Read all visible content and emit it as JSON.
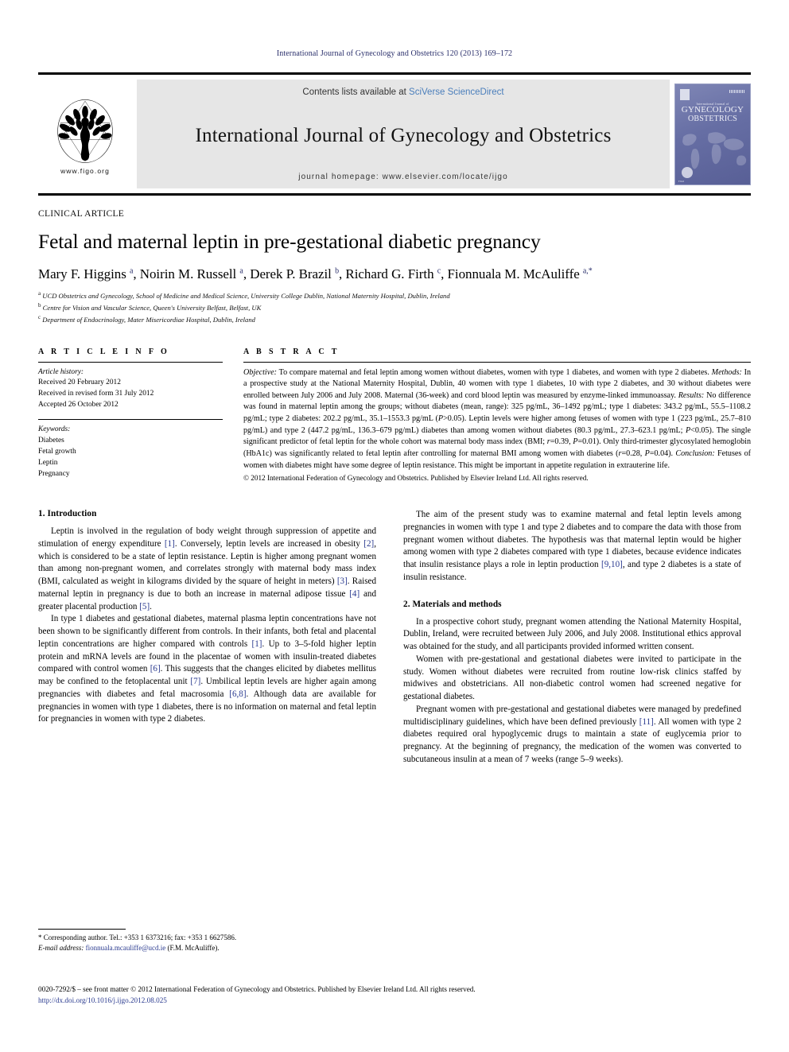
{
  "running_head": "International Journal of Gynecology and Obstetrics 120 (2013) 169–172",
  "masthead": {
    "figo_url": "www.figo.org",
    "contents_prefix": "Contents lists available at",
    "sciencedirect": "SciVerse ScienceDirect",
    "journal_title": "International Journal of Gynecology and Obstetrics",
    "homepage": "journal homepage: www.elsevier.com/locate/ijgo",
    "cover": {
      "kicker": "International Journal of",
      "line1": "GYNECOLOGY",
      "line2": "OBSTETRICS",
      "seal_text": "FIGO"
    }
  },
  "article": {
    "kicker": "CLINICAL ARTICLE",
    "title": "Fetal and maternal leptin in pre-gestational diabetic pregnancy",
    "authors_html": "Mary F. Higgins <sup>a</sup>, Noirin M. Russell <sup>a</sup>, Derek P. Brazil <sup>b</sup>, Richard G. Firth <sup>c</sup>, Fionnuala M. McAuliffe <sup>a,*</sup>",
    "affiliations": [
      {
        "marker": "a",
        "text": "UCD Obstetrics and Gynecology, School of Medicine and Medical Science, University College Dublin, National Maternity Hospital, Dublin, Ireland"
      },
      {
        "marker": "b",
        "text": "Centre for Vision and Vascular Science, Queen's University Belfast, Belfast, UK"
      },
      {
        "marker": "c",
        "text": "Department of Endocrinology, Mater Misericordiae Hospital, Dublin, Ireland"
      }
    ]
  },
  "article_info": {
    "heading": "A R T I C L E     I N F O",
    "history_label": "Article history:",
    "history": [
      "Received 20 February 2012",
      "Received in revised form 31 July 2012",
      "Accepted 26 October 2012"
    ],
    "keywords_label": "Keywords:",
    "keywords": [
      "Diabetes",
      "Fetal growth",
      "Leptin",
      "Pregnancy"
    ]
  },
  "abstract": {
    "heading": "A B S T R A C T",
    "body_html": "<i>Objective:</i> To compare maternal and fetal leptin among women without diabetes, women with type 1 diabetes, and women with type 2 diabetes. <i>Methods:</i> In a prospective study at the National Maternity Hospital, Dublin, 40 women with type 1 diabetes, 10 with type 2 diabetes, and 30 without diabetes were enrolled between July 2006 and July 2008. Maternal (36-week) and cord blood leptin was measured by enzyme-linked immunoassay. <i>Results:</i> No difference was found in maternal leptin among the groups; without diabetes (mean, range): 325 pg/mL, 36–1492 pg/mL; type 1 diabetes: 343.2 pg/mL, 55.5–1108.2 pg/mL; type 2 diabetes: 202.2 pg/mL, 35.1–1553.3 pg/mL (<i>P</i>&gt;0.05). Leptin levels were higher among fetuses of women with type 1 (223 pg/mL, 25.7–810 pg/mL) and type 2 (447.2 pg/mL, 136.3–679 pg/mL) diabetes than among women without diabetes (80.3 pg/mL, 27.3–623.1 pg/mL; <i>P</i>&lt;0.05). The single significant predictor of fetal leptin for the whole cohort was maternal body mass index (BMI; <i>r</i>=0.39, <i>P</i>=0.01). Only third-trimester glycosylated hemoglobin (HbA1c) was significantly related to fetal leptin after controlling for maternal BMI among women with diabetes (<i>r</i>=0.28, <i>P</i>=0.04). <i>Conclusion:</i> Fetuses of women with diabetes might have some degree of leptin resistance. This might be important in appetite regulation in extrauterine life.",
    "copyright": "© 2012 International Federation of Gynecology and Obstetrics. Published by Elsevier Ireland Ltd. All rights reserved."
  },
  "sections": {
    "introduction_heading": "1. Introduction",
    "intro_p1_html": "Leptin is involved in the regulation of body weight through suppression of appetite and stimulation of energy expenditure <span class=\"ref\">[1]</span>. Conversely, leptin levels are increased in obesity <span class=\"ref\">[2]</span>, which is considered to be a state of leptin resistance. Leptin is higher among pregnant women than among non-pregnant women, and correlates strongly with maternal body mass index (BMI, calculated as weight in kilograms divided by the square of height in meters) <span class=\"ref\">[3]</span>. Raised maternal leptin in pregnancy is due to both an increase in maternal adipose tissue <span class=\"ref\">[4]</span> and greater placental production <span class=\"ref\">[5]</span>.",
    "intro_p2_html": "In type 1 diabetes and gestational diabetes, maternal plasma leptin concentrations have not been shown to be significantly different from controls. In their infants, both fetal and placental leptin concentrations are higher compared with controls <span class=\"ref\">[1]</span>. Up to 3–5-fold higher leptin protein and mRNA levels are found in the placentae of women with insulin-treated diabetes compared with control women <span class=\"ref\">[6]</span>. This suggests that the changes elicited by diabetes mellitus may be confined to the fetoplacental unit <span class=\"ref\">[7]</span>. Umbilical leptin levels are higher again among pregnancies with diabetes and fetal macrosomia <span class=\"ref\">[6,8]</span>. Although data are available for pregnancies in women with type 1 diabetes, there is no information on maternal and fetal leptin for pregnancies in women with type 2 diabetes.",
    "intro_p3_html": "The aim of the present study was to examine maternal and fetal leptin levels among pregnancies in women with type 1 and type 2 diabetes and to compare the data with those from pregnant women without diabetes. The hypothesis was that maternal leptin would be higher among women with type 2 diabetes compared with type 1 diabetes, because evidence indicates that insulin resistance plays a role in leptin production <span class=\"ref\">[9,10]</span>, and type 2 diabetes is a state of insulin resistance.",
    "methods_heading": "2. Materials and methods",
    "methods_p1_html": "In a prospective cohort study, pregnant women attending the National Maternity Hospital, Dublin, Ireland, were recruited between July 2006, and July 2008. Institutional ethics approval was obtained for the study, and all participants provided informed written consent.",
    "methods_p2_html": "Women with pre-gestational and gestational diabetes were invited to participate in the study. Women without diabetes were recruited from routine low-risk clinics staffed by midwives and obstetricians. All non-diabetic control women had screened negative for gestational diabetes.",
    "methods_p3_html": "Pregnant women with pre-gestational and gestational diabetes were managed by predefined multidisciplinary guidelines, which have been defined previously <span class=\"ref\">[11]</span>. All women with type 2 diabetes required oral hypoglycemic drugs to maintain a state of euglycemia prior to pregnancy. At the beginning of pregnancy, the medication of the women was converted to subcutaneous insulin at a mean of 7 weeks (range 5–9 weeks)."
  },
  "footnote": {
    "corresponding_html": "* Corresponding author. Tel.: +353 1 6373216; fax: +353 1 6627586.",
    "email_label": "E-mail address:",
    "email": "fionnuala.mcauliffe@ucd.ie",
    "email_suffix": "(F.M. McAuliffe)."
  },
  "footer": {
    "issn_line": "0020-7292/$ – see front matter © 2012 International Federation of Gynecology and Obstetrics. Published by Elsevier Ireland Ltd. All rights reserved.",
    "doi": "http://dx.doi.org/10.1016/j.ijgo.2012.08.025"
  },
  "colors": {
    "link_blue": "#2a3a8f",
    "sciencedirect_blue": "#4a7ebb",
    "banner_grey": "#e6e6e6",
    "cover_purple": "#666ea4"
  }
}
